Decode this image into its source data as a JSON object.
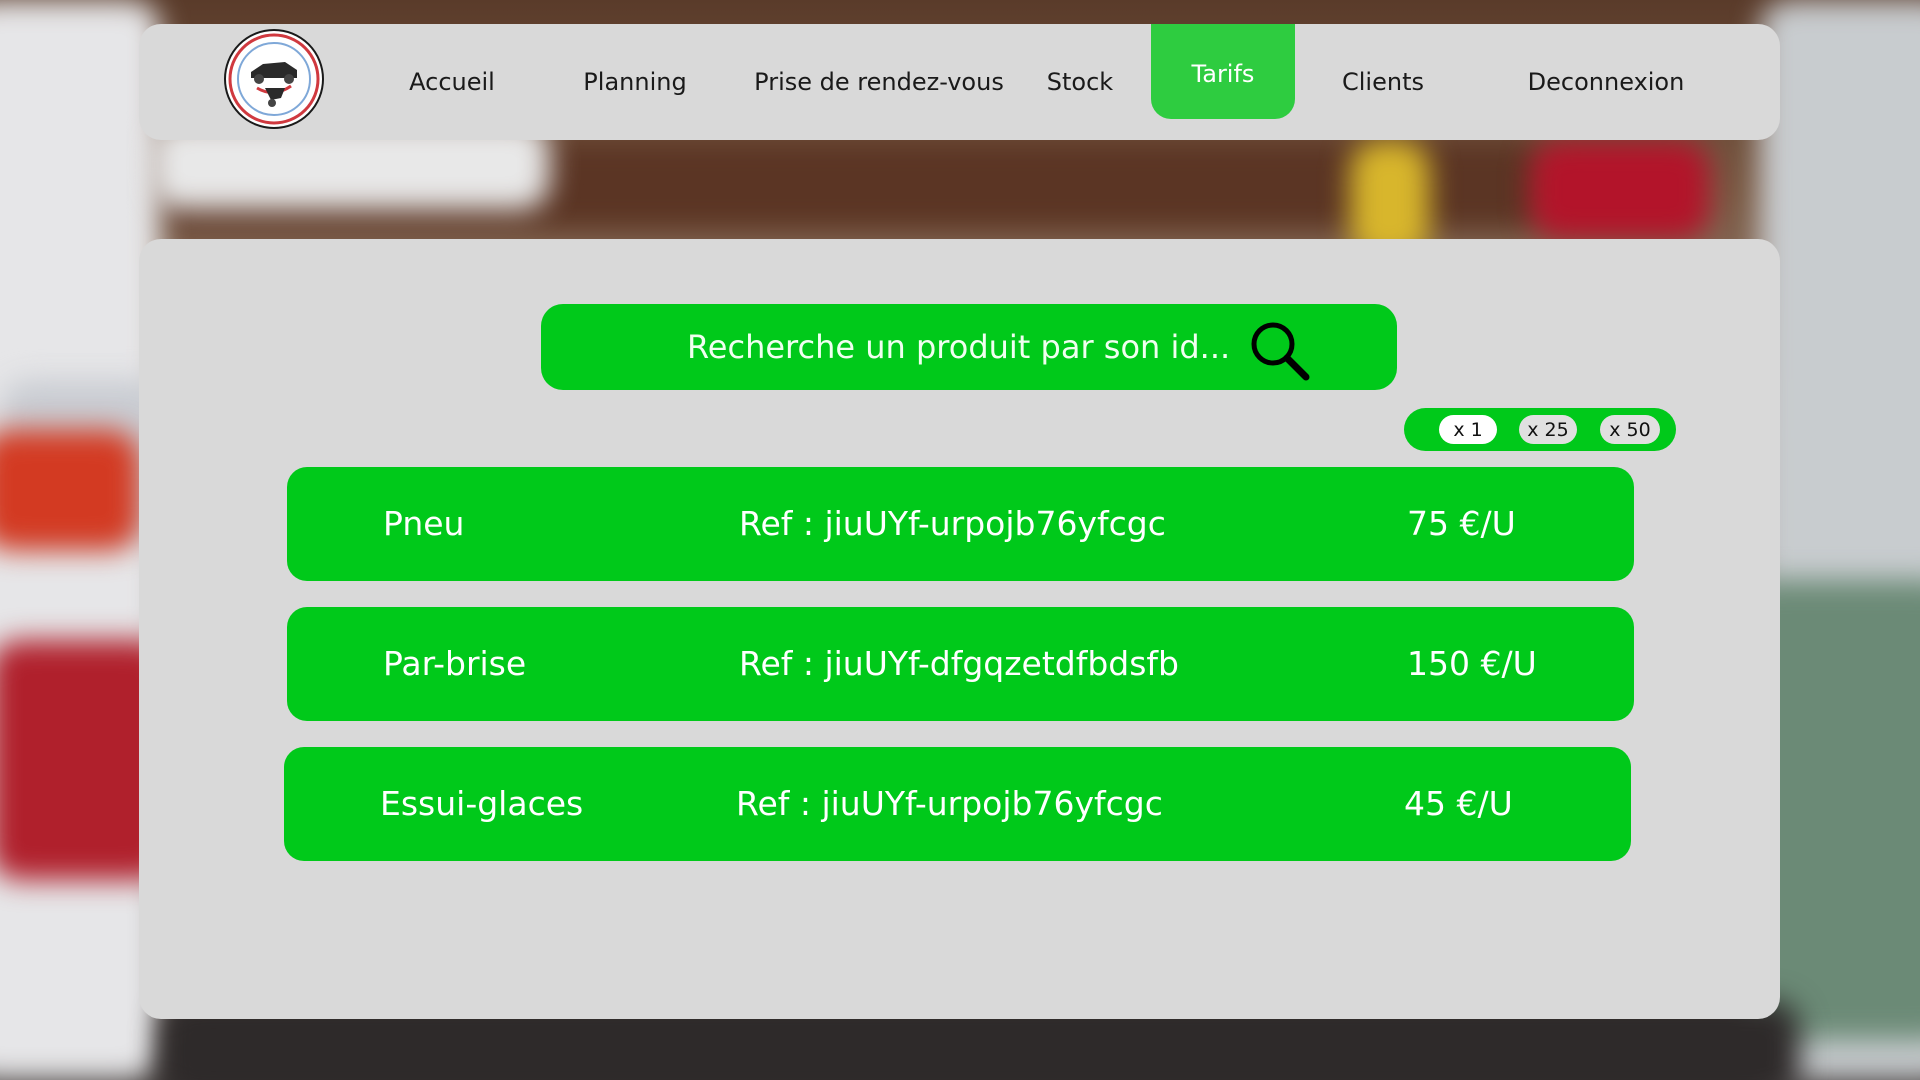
{
  "nav": {
    "logo_alt": "BESLIN GARAGE",
    "items": [
      {
        "label": "Accueil"
      },
      {
        "label": "Planning"
      },
      {
        "label": "Prise de rendez-vous"
      },
      {
        "label": "Stock"
      },
      {
        "label": "Tarifs",
        "active": true
      },
      {
        "label": "Clients"
      },
      {
        "label": "Deconnexion"
      }
    ]
  },
  "search": {
    "placeholder": "Recherche un produit par son id..."
  },
  "quantity": {
    "options": [
      {
        "label": "x 1",
        "selected": true
      },
      {
        "label": "x 25"
      },
      {
        "label": "x 50"
      }
    ]
  },
  "products": [
    {
      "name": "Pneu",
      "ref": "Ref : jiuUYf-urpojb76yfcgc",
      "price": "75 €/U"
    },
    {
      "name": "Par-brise",
      "ref": "Ref : jiuUYf-dfgqzetdfbdsfb",
      "price": "150 €/U"
    },
    {
      "name": "Essui-glaces",
      "ref": "Ref : jiuUYf-urpojb76yfcgc",
      "price": "45 €/U"
    }
  ],
  "colors": {
    "accent": "#00c91a",
    "nav_active": "#2ecc40",
    "panel": "#d9d9d9"
  }
}
